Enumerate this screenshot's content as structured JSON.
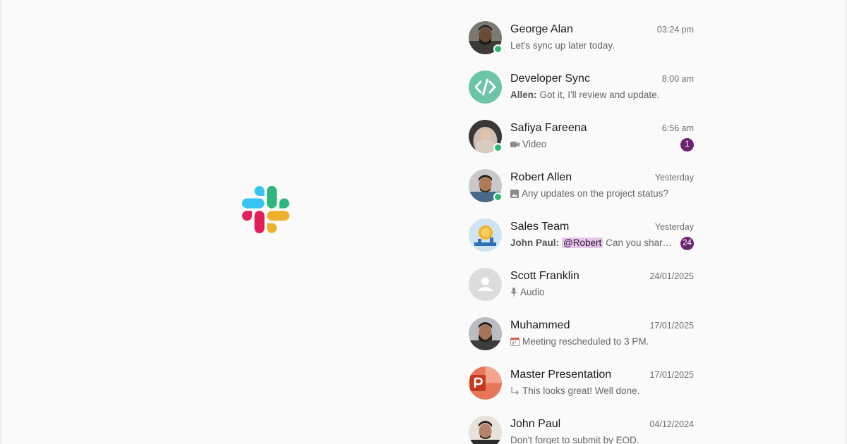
{
  "chats": [
    {
      "name": "George Alan",
      "time": "03:24 pm",
      "preview": "Let's sync up later today.",
      "online": true
    },
    {
      "name": "Developer Sync",
      "time": "8:00 am",
      "sender": "Allen:",
      "preview": "Got it, I'll review and update.",
      "online": false
    },
    {
      "name": "Safiya Fareena",
      "time": "6:56 am",
      "preview": "Video",
      "preview_icon": "video-icon",
      "unread": "1",
      "online": true
    },
    {
      "name": "Robert Allen",
      "time": "Yesterday",
      "preview": "Any updates on the project status?",
      "preview_icon": "image-icon",
      "online": true
    },
    {
      "name": "Sales Team",
      "time": "Yesterday",
      "sender": "John Paul:",
      "mention": "@Robert",
      "preview": "Can you share...",
      "unread": "24",
      "online": false
    },
    {
      "name": "Scott Franklin",
      "time": "24/01/2025",
      "preview": "Audio",
      "preview_icon": "microphone-icon",
      "online": false
    },
    {
      "name": "Muhammed",
      "time": "17/01/2025",
      "preview": "Meeting rescheduled to 3 PM.",
      "preview_icon": "calendar-icon",
      "online": false
    },
    {
      "name": "Master Presentation",
      "time": "17/01/2025",
      "preview": "This looks great! Well done.",
      "preview_icon": "reply-arrow-icon",
      "online": false
    },
    {
      "name": "John Paul",
      "time": "04/12/2024",
      "preview": "Don't forget to submit by EOD.",
      "online": false
    }
  ],
  "colors": {
    "online": "#2bb673",
    "badge": "#6b2470",
    "mention_bg": "#e3c8e6",
    "developer_sync_avatar": "#6cc5a8",
    "presentation_avatar": "#d04a2c"
  },
  "logo": "slack-logo"
}
